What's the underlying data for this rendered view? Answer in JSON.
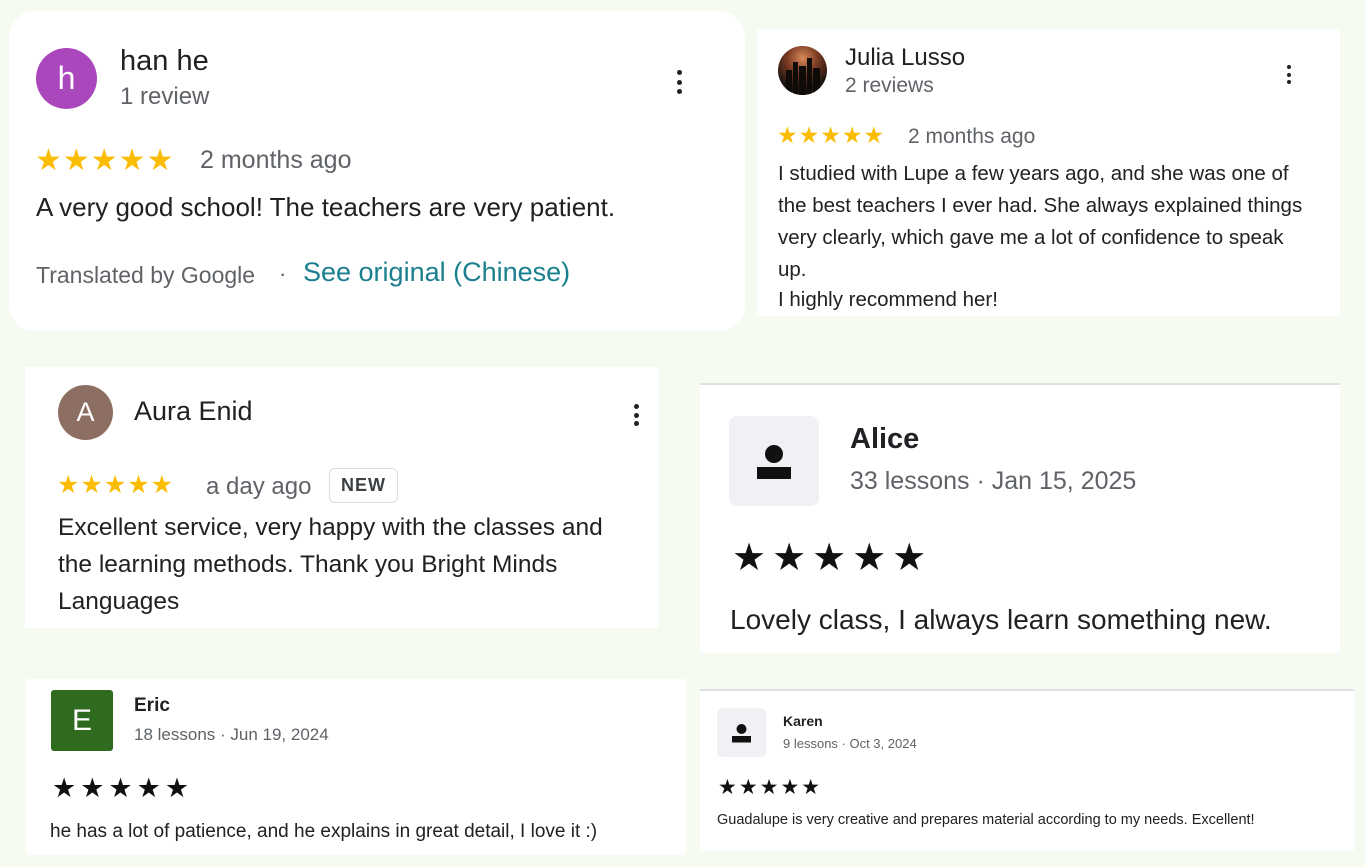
{
  "reviews": {
    "han": {
      "avatar_letter": "h",
      "name": "han he",
      "meta": "1 review",
      "stars": "★★★★★",
      "rating": 5,
      "date": "2 months ago",
      "text": "A very good school! The teachers are very patient.",
      "translated": "Translated by Google",
      "separator": "·",
      "see_original": "See original (Chinese)",
      "avatar_color": "#ab47bc",
      "link_color": "#1a7f8e"
    },
    "julia": {
      "name": "Julia Lusso",
      "meta": "2 reviews",
      "stars": "★★★★★",
      "rating": 5,
      "date": "2 months ago",
      "text": "I studied with Lupe a few years ago, and she was one of the best teachers I ever had. She always explained things very clearly, which gave me a lot of confidence to speak up.",
      "text2": "I highly recommend her!"
    },
    "aura": {
      "avatar_letter": "A",
      "name": "Aura Enid",
      "stars": "★★★★★",
      "rating": 5,
      "date": "a day ago",
      "badge": "NEW",
      "text": "Excellent service, very happy with the classes and the learning methods. Thank you Bright Minds Languages",
      "avatar_color": "#8d6e63"
    },
    "alice": {
      "name": "Alice",
      "meta": "33 lessons · Jan 15, 2025",
      "stars": "★★★★★",
      "rating": 5,
      "text": "Lovely class, I always learn something new."
    },
    "eric": {
      "avatar_letter": "E",
      "name": "Eric",
      "meta": "18 lessons · Jun 19, 2024",
      "stars": "★★★★★",
      "rating": 5,
      "text": "he has a lot of patience, and he explains in great detail, I love it :)",
      "avatar_color": "#2e6b1f"
    },
    "karen": {
      "name": "Karen",
      "meta": "9 lessons · Oct 3, 2024",
      "stars": "★★★★★",
      "rating": 5,
      "text": "Guadalupe is very creative and prepares material according to my needs. Excellent!"
    }
  }
}
